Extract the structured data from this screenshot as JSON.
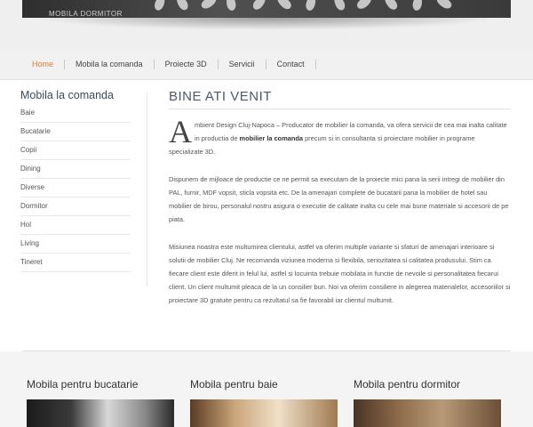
{
  "header": {
    "banner_text": "MOBILA DORMITOR"
  },
  "nav": {
    "items": [
      "Home",
      "Mobila la comanda",
      "Proiecte 3D",
      "Servicii",
      "Contact"
    ],
    "active_color": "#e07a2e"
  },
  "sidebar": {
    "title": "Mobila la comanda",
    "items": [
      "Baie",
      "Bucatarie",
      "Copii",
      "Dining",
      "Diverse",
      "Dormitor",
      "Hol",
      "Living",
      "Tineret"
    ]
  },
  "main": {
    "title": "BINE ATI VENIT",
    "p1_dropcap": "A",
    "p1_text_a": "mbient Design Cluj-Napoca – Producator de mobilier la comanda, va ofera servicii de cea mai inalta calitate in productia de ",
    "p1_bold": "mobilier la comanda",
    "p1_text_b": " precum si in consultanta si proiectare mobilier in programe specializate 3D.",
    "p2": "Dispunem de mijloace de productie ce ne permit sa executam de la proiecte mici pana la serii intregi de mobilier din PAL, furnir, MDF vopsit, sticla vopsita etc. De la amenajari complete de bucatarii pana la mobilier de hotel sau mobilier de birou, personalul nostru asigura o executie de calitate inalta cu cele mai bune materiale si accesorii de pe piata.",
    "p3": "Misiunea noastra este multumirea clientului, astfel va oferim multiple variante si sfaturi de amenajari interioare si solutii de mobilier Cluj. Ne recomanda viziunea moderna si flexibila, seriozitatea si calitatea produsului. Stim ca fiecare client este diferit in felul lui, astfel si locuinta trebuie mobilata in functie de nevoile si personalitatea fiecarui client. Un client multumit pleaca de la un consilier bun. Noi va oferim consiliere in alegerea materialelor, accesoriilor si proiectare 3D gratuite pentru ca rezultatul sa fie favorabil iar clientul multumit."
  },
  "featured": [
    {
      "title": "Mobila pentru bucatarie"
    },
    {
      "title": "Mobila pentru baie"
    },
    {
      "title": "Mobila pentru dormitor"
    }
  ]
}
